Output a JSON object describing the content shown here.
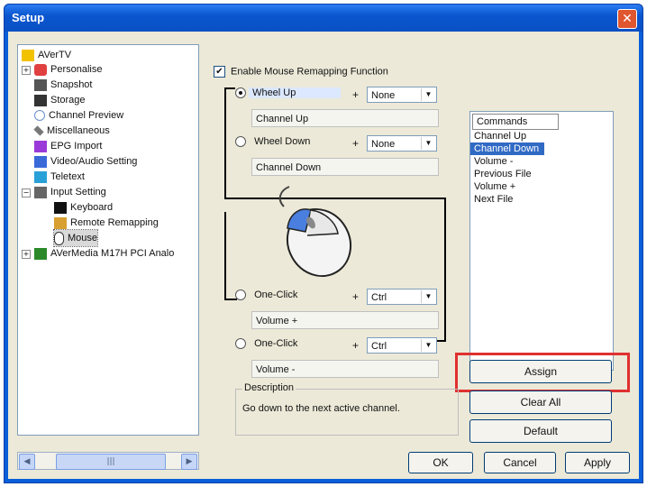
{
  "window": {
    "title": "Setup"
  },
  "tree": {
    "items": [
      {
        "label": "AVerTV"
      },
      {
        "label": "Personalise"
      },
      {
        "label": "Snapshot"
      },
      {
        "label": "Storage"
      },
      {
        "label": "Channel Preview"
      },
      {
        "label": "Miscellaneous"
      },
      {
        "label": "EPG Import"
      },
      {
        "label": "Video/Audio Setting"
      },
      {
        "label": "Teletext"
      },
      {
        "label": "Input Setting"
      },
      {
        "label": "Keyboard"
      },
      {
        "label": "Remote Remapping"
      },
      {
        "label": "Mouse"
      },
      {
        "label": "AVerMedia M17H PCI Analo"
      }
    ]
  },
  "mouse": {
    "enable_label": "Enable Mouse Remapping Function",
    "wheel_up": {
      "label": "Wheel Up",
      "modifier": "None",
      "command": "Channel Up"
    },
    "wheel_down": {
      "label": "Wheel Down",
      "modifier": "None",
      "command": "Channel Down"
    },
    "one_click_1": {
      "label": "One-Click",
      "modifier": "Ctrl",
      "command": "Volume +"
    },
    "one_click_2": {
      "label": "One-Click",
      "modifier": "Ctrl",
      "command": "Volume -"
    },
    "plus": "+"
  },
  "commands": {
    "header": "Commands",
    "items": [
      "Channel Up",
      "Channel Down",
      "Volume -",
      "Previous File",
      "Volume +",
      "Next File"
    ]
  },
  "buttons": {
    "assign": "Assign",
    "clear_all": "Clear All",
    "default": "Default",
    "ok": "OK",
    "cancel": "Cancel",
    "apply": "Apply"
  },
  "description": {
    "label": "Description",
    "text": "Go down to the next active channel."
  },
  "colors": {
    "accent": "#0a5fd8",
    "highlight": "#e03030",
    "selection": "#316ac5"
  }
}
